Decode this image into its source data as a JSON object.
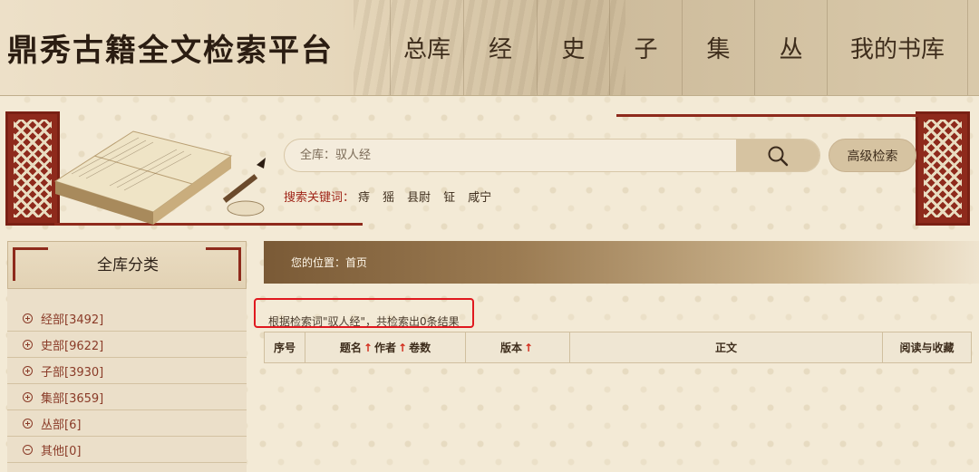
{
  "header": {
    "logo_text": "鼎秀古籍全文检索平台",
    "nav": [
      "总库",
      "经",
      "史",
      "子",
      "集",
      "丛",
      "我的书库"
    ]
  },
  "search": {
    "value": "",
    "placeholder": "全库：驭人经",
    "advanced_label": "高级检索",
    "keywords_label": "搜索关键词：",
    "keywords": [
      "痔",
      "猺",
      "县尉",
      "钲",
      "咸宁"
    ]
  },
  "sidebar": {
    "title": "全库分类",
    "items": [
      {
        "label": "经部[3492]",
        "icon": "plus-circle-icon"
      },
      {
        "label": "史部[9622]",
        "icon": "plus-circle-icon"
      },
      {
        "label": "子部[3930]",
        "icon": "plus-circle-icon"
      },
      {
        "label": "集部[3659]",
        "icon": "plus-circle-icon"
      },
      {
        "label": "丛部[6]",
        "icon": "plus-circle-icon"
      },
      {
        "label": "其他[0]",
        "icon": "minus-circle-icon"
      }
    ]
  },
  "breadcrumb": "您的位置：首页",
  "result_summary": "根据检索词\"驭人经\"，共检索出0条结果",
  "table": {
    "columns": {
      "index": "序号",
      "title": "题名",
      "author": "作者",
      "volumes": "卷数",
      "edition": "版本",
      "text": "正文",
      "read_collect": "阅读与收藏"
    },
    "sort_icon": "red-up-arrow-icon"
  },
  "colors": {
    "accent_red": "#8e2a1c",
    "highlight_red": "#e0191f",
    "background": "#f3ead6"
  }
}
